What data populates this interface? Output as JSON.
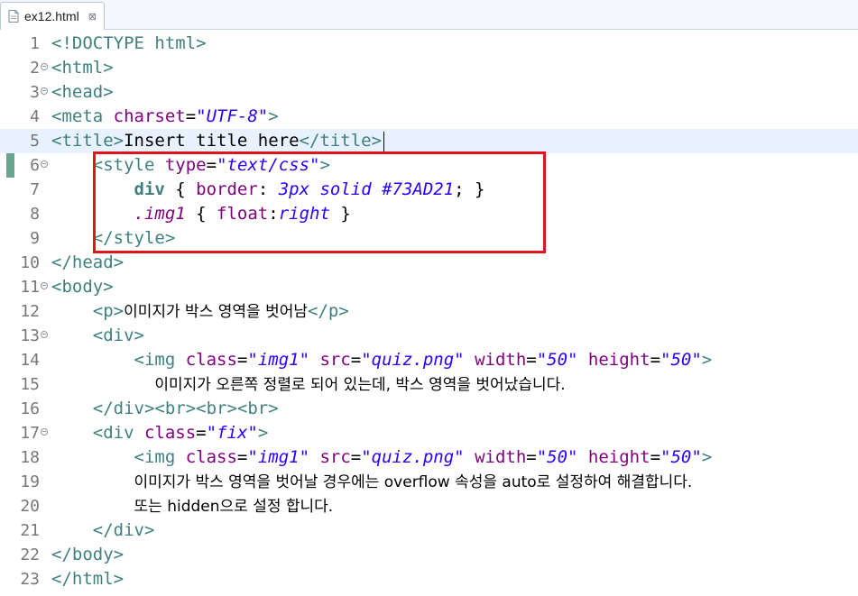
{
  "tab": {
    "filename": "ex12.html",
    "close_symbol": "⊠"
  },
  "icons": {
    "file": "html-file-icon",
    "close": "close-icon",
    "fold": "fold-icon"
  },
  "colors": {
    "tag": "#3f7f7f",
    "attribute": "#7f007f",
    "value": "#2a00ff",
    "highlight_box": "#e0151b",
    "current_line": "#e8f2fe"
  },
  "lines": [
    {
      "n": "1",
      "parts": [
        "<!DOCTYPE html>"
      ]
    },
    {
      "n": "2",
      "parts": [
        "<html>"
      ]
    },
    {
      "n": "3",
      "parts": [
        "<head>"
      ]
    },
    {
      "n": "4",
      "parts": [
        "<meta",
        " charset",
        "=",
        "\"UTF-8\"",
        ">"
      ]
    },
    {
      "n": "5",
      "parts": [
        "<title>",
        "Insert title here",
        "</title>"
      ]
    },
    {
      "n": "6",
      "parts": [
        "<style",
        " type",
        "=",
        "\"text/css\"",
        ">"
      ]
    },
    {
      "n": "7",
      "parts": [
        "div",
        " { ",
        "border",
        ": ",
        "3px solid #73AD21",
        "; }"
      ]
    },
    {
      "n": "8",
      "parts": [
        ".img1",
        " { ",
        "float",
        ":",
        "right",
        " }"
      ]
    },
    {
      "n": "9",
      "parts": [
        "</style>"
      ]
    },
    {
      "n": "10",
      "parts": [
        "</head>"
      ]
    },
    {
      "n": "11",
      "parts": [
        "<body>"
      ]
    },
    {
      "n": "12",
      "parts": [
        "<p>",
        "이미지가 박스 영역을 벗어남",
        "</p>"
      ]
    },
    {
      "n": "13",
      "parts": [
        "<div>"
      ]
    },
    {
      "n": "14",
      "parts": [
        "<img",
        " class",
        "=",
        "\"img1\"",
        " src",
        "=",
        "\"quiz.png\"",
        " width",
        "=",
        "\"50\"",
        " height",
        "=",
        "\"50\"",
        ">"
      ]
    },
    {
      "n": "15",
      "parts": [
        "이미지가 오른쪽 정렬로 되어 있는데, 박스 영역을 벗어났습니다."
      ]
    },
    {
      "n": "16",
      "parts": [
        "</div><br><br><br>"
      ]
    },
    {
      "n": "17",
      "parts": [
        "<div",
        " class",
        "=",
        "\"fix\"",
        ">"
      ]
    },
    {
      "n": "18",
      "parts": [
        "<img",
        " class",
        "=",
        "\"img1\"",
        " src",
        "=",
        "\"quiz.png\"",
        " width",
        "=",
        "\"50\"",
        " height",
        "=",
        "\"50\"",
        ">"
      ]
    },
    {
      "n": "19",
      "parts": [
        "이미지가 박스 영역을 벗어날 경우에는 overflow 속성을 auto로 설정하여 해결합니다."
      ]
    },
    {
      "n": "20",
      "parts": [
        "또는 hidden으로 설정 합니다."
      ]
    },
    {
      "n": "21",
      "parts": [
        "</div>"
      ]
    },
    {
      "n": "22",
      "parts": [
        "</body>"
      ]
    },
    {
      "n": "23",
      "parts": [
        "</html>"
      ]
    }
  ]
}
